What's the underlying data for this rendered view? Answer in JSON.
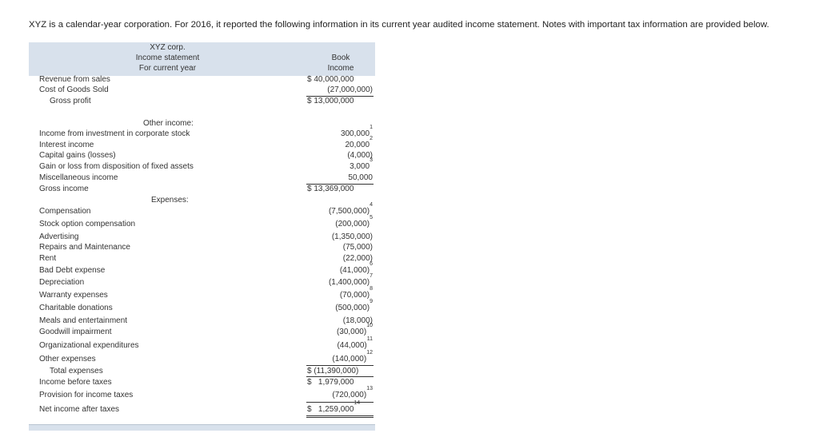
{
  "intro": "XYZ is a calendar-year corporation. For 2016, it reported the following information in its current year audited income statement. Notes with important tax information are provided below.",
  "header": {
    "company": "XYZ corp.",
    "statement": "Income statement",
    "period": "For current year",
    "column_line1": "Book",
    "column_line2": "Income"
  },
  "rows": {
    "revenue": {
      "label": "Revenue from sales",
      "value": "$ 40,000,000",
      "note": ""
    },
    "cogs": {
      "label": "Cost of Goods Sold",
      "value": "(27,000,000)",
      "note": ""
    },
    "gross_profit": {
      "label": "Gross profit",
      "value": "$ 13,000,000",
      "note": ""
    },
    "other_income_heading": {
      "label": "Other income:"
    },
    "inv_income": {
      "label": "Income from investment in corporate stock",
      "value": "300,000",
      "note": "1"
    },
    "interest": {
      "label": "Interest income",
      "value": "20,000",
      "note": "2"
    },
    "capital": {
      "label": "Capital gains (losses)",
      "value": "(4,000)",
      "note": ""
    },
    "gain_loss": {
      "label": "Gain or loss from disposition of fixed assets",
      "value": "3,000",
      "note": "3"
    },
    "misc": {
      "label": "Miscellaneous income",
      "value": "50,000",
      "note": ""
    },
    "gross_income": {
      "label": "Gross income",
      "value": "$ 13,369,000",
      "note": ""
    },
    "expenses_heading": {
      "label": "Expenses:"
    },
    "compensation": {
      "label": "Compensation",
      "value": "(7,500,000)",
      "note": "4"
    },
    "stock_option": {
      "label": "Stock option compensation",
      "value": "(200,000)",
      "note": "5"
    },
    "advertising": {
      "label": "Advertising",
      "value": "(1,350,000)",
      "note": ""
    },
    "repairs": {
      "label": "Repairs and Maintenance",
      "value": "(75,000)",
      "note": ""
    },
    "rent": {
      "label": "Rent",
      "value": "(22,000)",
      "note": ""
    },
    "bad_debt": {
      "label": "Bad Debt expense",
      "value": "(41,000)",
      "note": "6"
    },
    "depreciation": {
      "label": "Depreciation",
      "value": "(1,400,000)",
      "note": "7"
    },
    "warranty": {
      "label": "Warranty expenses",
      "value": "(70,000)",
      "note": "8"
    },
    "charitable": {
      "label": "Charitable donations",
      "value": "(500,000)",
      "note": "9"
    },
    "meals": {
      "label": "Meals and entertainment",
      "value": "(18,000)",
      "note": ""
    },
    "goodwill": {
      "label": "Goodwill impairment",
      "value": "(30,000)",
      "note": "10"
    },
    "organizational": {
      "label": "Organizational expenditures",
      "value": "(44,000)",
      "note": "11"
    },
    "other_exp": {
      "label": "Other expenses",
      "value": "(140,000)",
      "note": "12"
    },
    "total_exp": {
      "label": "Total expenses",
      "value": "$ (11,390,000)",
      "note": ""
    },
    "income_before": {
      "label": "Income before taxes",
      "value": "$   1,979,000",
      "note": ""
    },
    "provision": {
      "label": "Provision for income taxes",
      "value": "(720,000)",
      "note": "13"
    },
    "net_income": {
      "label": "Net income after taxes",
      "value": "$   1,259,000",
      "note": "14"
    }
  }
}
